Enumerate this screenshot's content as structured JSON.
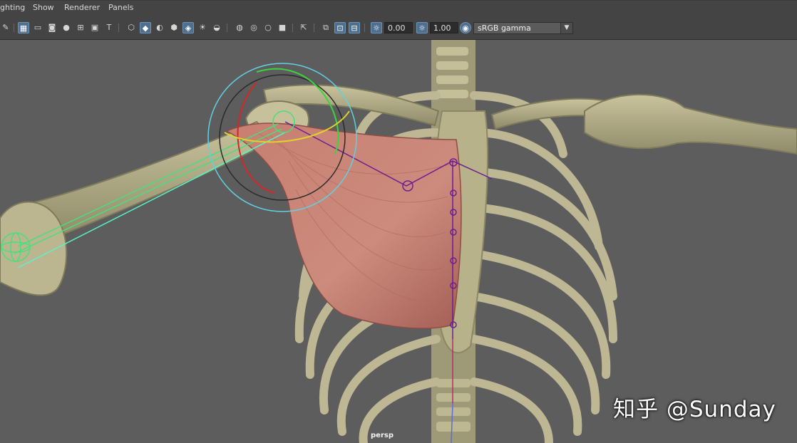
{
  "menu": {
    "items": [
      "ghting",
      "Show",
      "Renderer",
      "Panels"
    ]
  },
  "toolbar": {
    "exposure_value": "0.00",
    "gamma_value": "1.00",
    "color_space": "sRGB gamma",
    "icons": [
      "select-camera-icon",
      "grid-icon",
      "film-gate-icon",
      "resolution-gate-icon",
      "gate-mask-icon",
      "field-chart-icon",
      "safe-action-icon",
      "safe-title-icon",
      "wireframe-icon",
      "smooth-shade-icon",
      "default-material-icon",
      "wireframe-on-shaded-icon",
      "xray-icon",
      "lights-icon",
      "shadows-icon",
      "screen-space-ao-icon",
      "motion-blur-icon",
      "multisample-aa-icon",
      "depth-of-field-icon",
      "isolate-select-icon",
      "xray-joints-icon",
      "xray-active-icon",
      "exposure-toggle-icon",
      "gamma-toggle-icon",
      "view-transform-icon"
    ],
    "dropdown_arrow": "chevron-down-icon"
  },
  "viewport": {
    "camera": "persp",
    "watermark": "知乎 @Sunday",
    "background": "#5d5d5d",
    "bone_color": "#b8b48f",
    "muscle_color": "#c97b6c",
    "joint_color": "#6b1f8f",
    "control_color": "#5fd1e3"
  }
}
